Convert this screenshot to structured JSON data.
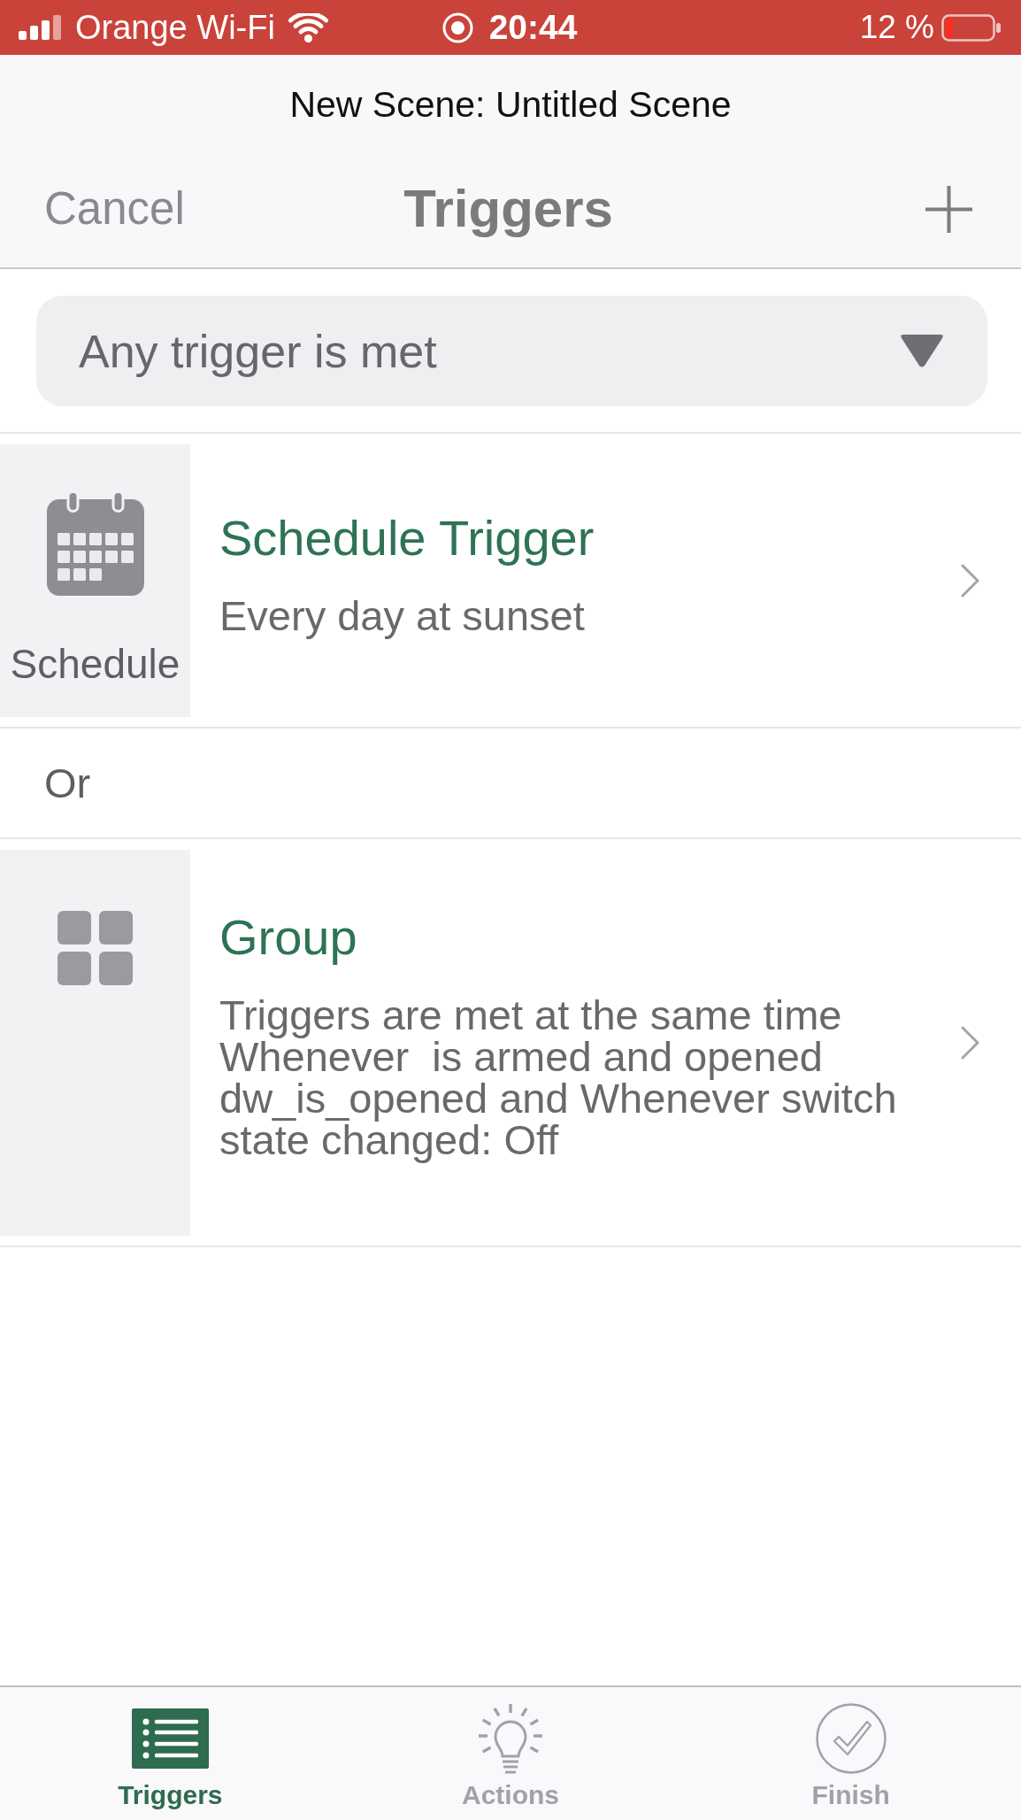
{
  "status_bar": {
    "carrier": "Orange Wi-Fi",
    "time": "20:44",
    "battery": "12 %"
  },
  "navigation": {
    "subtitle": "New Scene: Untitled Scene",
    "cancel": "Cancel",
    "title": "Triggers"
  },
  "condition_dropdown": {
    "value": "Any trigger is met"
  },
  "items": [
    {
      "kind": "schedule",
      "icon_label": "Schedule",
      "title": "Schedule Trigger",
      "description": "Every day at sunset"
    },
    {
      "kind": "connector",
      "label": "Or"
    },
    {
      "kind": "group",
      "title": "Group",
      "description": "Triggers are met at the same time Whenever  is armed and opened dw_is_opened and Whenever switch state changed: Off"
    }
  ],
  "tabs": [
    {
      "kind": "list",
      "label": "Triggers",
      "selected": true
    },
    {
      "kind": "lightbulb",
      "label": "Actions",
      "selected": false
    },
    {
      "kind": "checkmark",
      "label": "Finish",
      "selected": false
    }
  ]
}
